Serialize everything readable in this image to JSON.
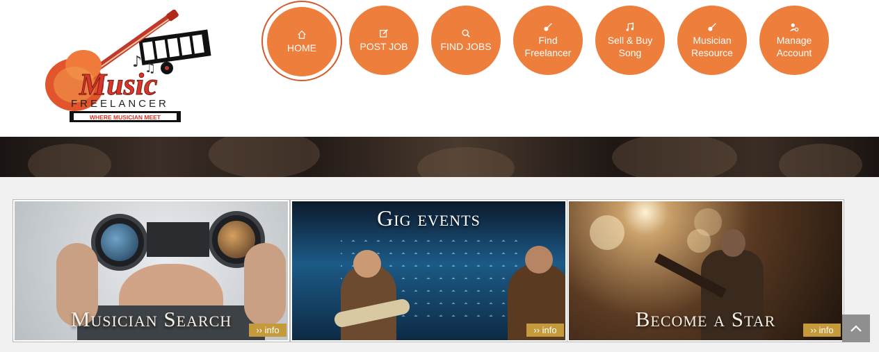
{
  "brand": {
    "logo_title": "Music",
    "logo_subtitle": "FREELANCER",
    "logo_tagline": "WHERE MUSICIAN MEET",
    "accent_color": "#ee7e3b"
  },
  "nav": {
    "items": [
      {
        "label": "HOME",
        "icon": "home-icon",
        "active": true
      },
      {
        "label": "POST JOB",
        "icon": "edit-icon"
      },
      {
        "label": "FIND JOBS",
        "icon": "search-icon"
      },
      {
        "label": "Find Freelancer",
        "icon": "guitar-icon"
      },
      {
        "label": "Sell & Buy Song",
        "icon": "music-note-icon"
      },
      {
        "label": "Musician Resource",
        "icon": "guitar-icon"
      },
      {
        "label": "Manage Account",
        "icon": "user-settings-icon"
      }
    ]
  },
  "tiles": [
    {
      "caption": "Musician Search",
      "info_label": "›› info"
    },
    {
      "caption": "Gig events",
      "info_label": "›› info"
    },
    {
      "caption": "Become a Star",
      "info_label": "›› info"
    }
  ],
  "scroll_top": {
    "icon": "chevron-up-icon"
  }
}
